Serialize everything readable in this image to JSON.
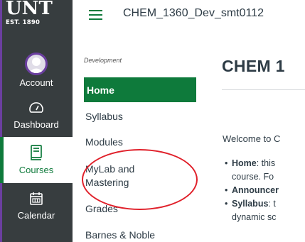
{
  "global_nav": {
    "logo_main": "UNT",
    "logo_sub": "EST. 1890",
    "items": [
      {
        "label": "Account",
        "icon": "avatar"
      },
      {
        "label": "Dashboard",
        "icon": "dashboard-icon"
      },
      {
        "label": "Courses",
        "icon": "book-icon"
      },
      {
        "label": "Calendar",
        "icon": "calendar-icon"
      }
    ],
    "colors": {
      "background": "#373d3f",
      "active_text": "#0e7a3b",
      "accent": "#6b3fa0"
    }
  },
  "header": {
    "course_title": "CHEM_1360_Dev_smt0112"
  },
  "course_nav": {
    "section_label": "Development",
    "items": [
      {
        "label": "Home"
      },
      {
        "label": "Syllabus"
      },
      {
        "label": "Modules"
      },
      {
        "label": "MyLab and"
      },
      {
        "label": "Mastering"
      },
      {
        "label": "Grades"
      },
      {
        "label": "Barnes & Noble"
      }
    ],
    "active_color": "#0e7a3b"
  },
  "main": {
    "page_title": "CHEM 1",
    "welcome": "Welcome to C",
    "bullets": [
      {
        "bold": "Home",
        "text": ": this"
      },
      {
        "bold": "",
        "text": "course.  Fo"
      },
      {
        "bold": "Announcer",
        "text": ""
      },
      {
        "bold": "Syllabus",
        "text": ": t"
      },
      {
        "bold": "",
        "text": "dynamic sc"
      }
    ]
  },
  "annotation": {
    "color": "#e0202a"
  }
}
